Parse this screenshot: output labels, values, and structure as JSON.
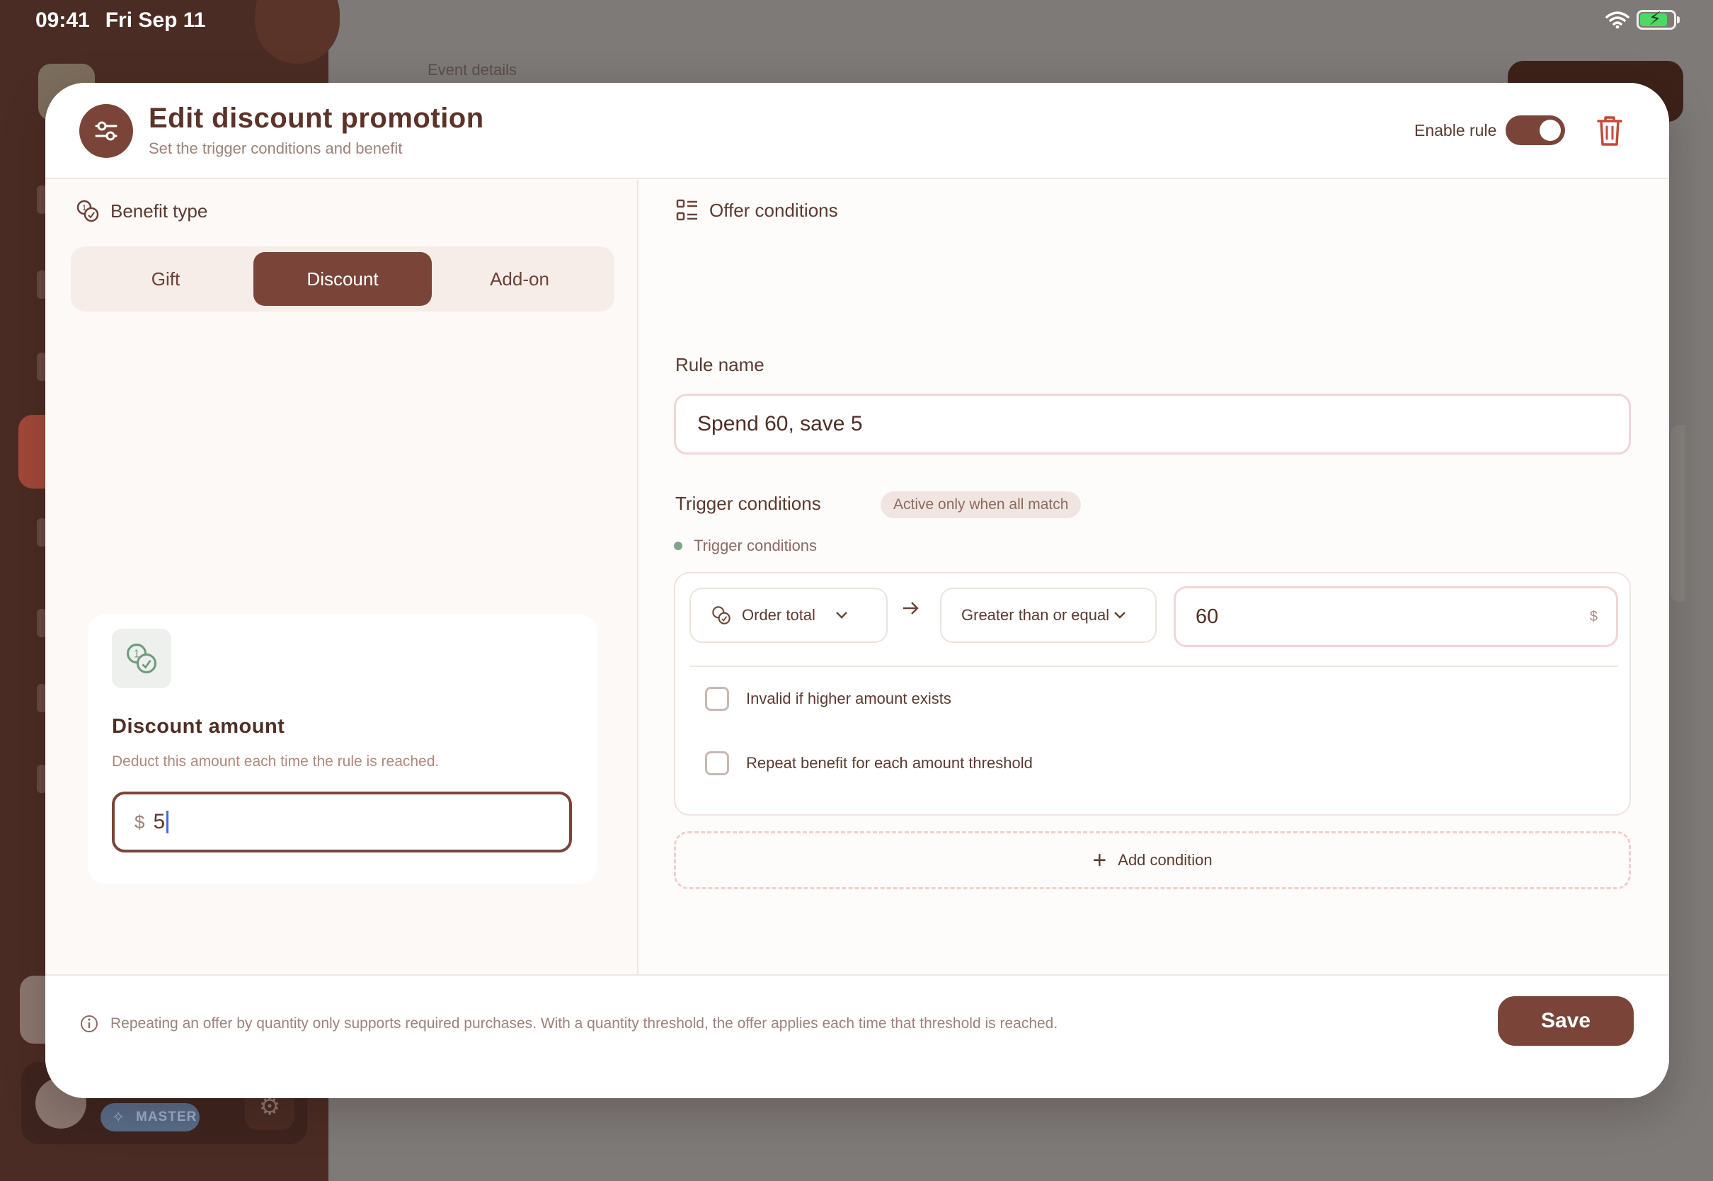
{
  "status_bar": {
    "time": "09:41",
    "date": "Fri Sep 11"
  },
  "background": {
    "event_details": "Event details",
    "master_badge": "MASTER"
  },
  "modal": {
    "title": "Edit discount promotion",
    "subtitle": "Set the trigger conditions and benefit",
    "enable_label": "Enable rule",
    "enabled": true
  },
  "benefit": {
    "section_title": "Benefit type",
    "options": [
      "Gift",
      "Discount",
      "Add-on"
    ],
    "selected": "Discount",
    "card": {
      "title": "Discount amount",
      "description": "Deduct this amount each time the rule is reached.",
      "currency": "$",
      "value": "5"
    }
  },
  "conditions": {
    "section_title": "Offer conditions",
    "rule_name_label": "Rule name",
    "rule_name_value": "Spend 60, save 5",
    "trigger_label": "Trigger conditions",
    "trigger_badge": "Active only when all match",
    "group_label": "Trigger conditions",
    "field": "Order total",
    "operator": "Greater than or equal",
    "value": "60",
    "unit": "$",
    "options": [
      "Invalid if higher amount exists",
      "Repeat benefit for each amount threshold"
    ],
    "add_condition": "Add condition"
  },
  "footer": {
    "note": "Repeating an offer by quantity only supports required purchases. With a quantity threshold, the offer applies each time that threshold is reached.",
    "save": "Save"
  },
  "colors": {
    "accent": "#7a4538",
    "positive": "#7fa58a",
    "text": "#4f2f26"
  }
}
